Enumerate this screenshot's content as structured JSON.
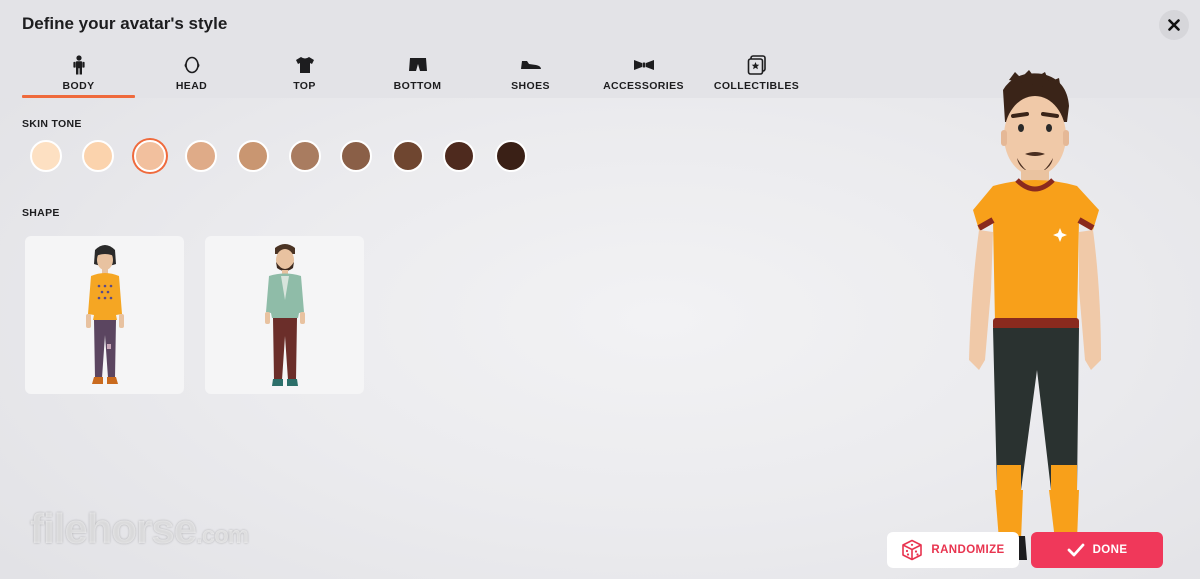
{
  "header": {
    "title": "Define your avatar's style"
  },
  "tabs": [
    {
      "label": "BODY",
      "icon": "person-icon",
      "active": true
    },
    {
      "label": "HEAD",
      "icon": "head-icon",
      "active": false
    },
    {
      "label": "TOP",
      "icon": "shirt-icon",
      "active": false
    },
    {
      "label": "BOTTOM",
      "icon": "shorts-icon",
      "active": false
    },
    {
      "label": "SHOES",
      "icon": "shoe-icon",
      "active": false
    },
    {
      "label": "ACCESSORIES",
      "icon": "bowtie-icon",
      "active": false
    },
    {
      "label": "COLLECTIBLES",
      "icon": "star-card-icon",
      "active": false
    }
  ],
  "skin_tone": {
    "label": "SKIN TONE",
    "selected_index": 2,
    "colors": [
      "#fde0c2",
      "#fbd3ad",
      "#f2c09e",
      "#dfab88",
      "#c99671",
      "#a97c60",
      "#8a5f47",
      "#6f4630",
      "#4e2a1e",
      "#3a2016"
    ]
  },
  "shape": {
    "label": "SHAPE",
    "options": [
      "feminine-body",
      "masculine-body"
    ]
  },
  "actions": {
    "randomize_label": "RANDOMIZE",
    "done_label": "DONE"
  },
  "watermark": {
    "text": "filehorse",
    "suffix": ".com"
  },
  "colors": {
    "accent": "#ef6a3c",
    "done_button": "#f0385a",
    "randomize_text": "#e8344f"
  }
}
